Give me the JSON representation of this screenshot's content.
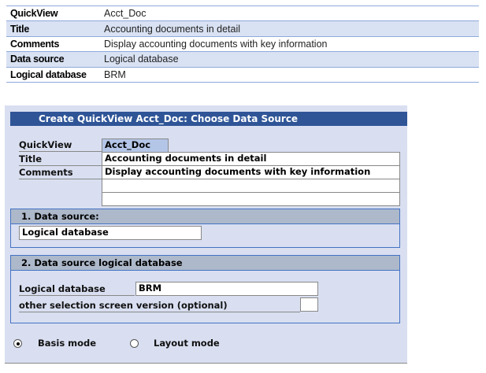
{
  "summary_table": [
    {
      "label": "QuickView",
      "value": "Acct_Doc"
    },
    {
      "label": "Title",
      "value": "Accounting documents in detail"
    },
    {
      "label": "Comments",
      "value": "Display accounting documents with key information"
    },
    {
      "label": "Data source",
      "value": "Logical database"
    },
    {
      "label": "Logical database",
      "value": "BRM"
    }
  ],
  "dialog": {
    "title": "Create QuickView Acct_Doc: Choose Data Source",
    "quickview_label": "QuickView",
    "quickview_value": "Acct_Doc",
    "title_label": "Title",
    "title_value": "Accounting documents in detail",
    "comments_label": "Comments",
    "comments_value": "Display accounting documents with key information",
    "section1": {
      "heading": "1. Data source:",
      "value": "Logical database"
    },
    "section2": {
      "heading": "2. Data source logical database",
      "ldb_label": "Logical database",
      "ldb_value": "BRM",
      "version_label": "other selection screen version (optional)",
      "version_value": ""
    },
    "modes": [
      {
        "label": "Basis mode",
        "selected": true
      },
      {
        "label": "Layout mode",
        "selected": false
      }
    ]
  }
}
